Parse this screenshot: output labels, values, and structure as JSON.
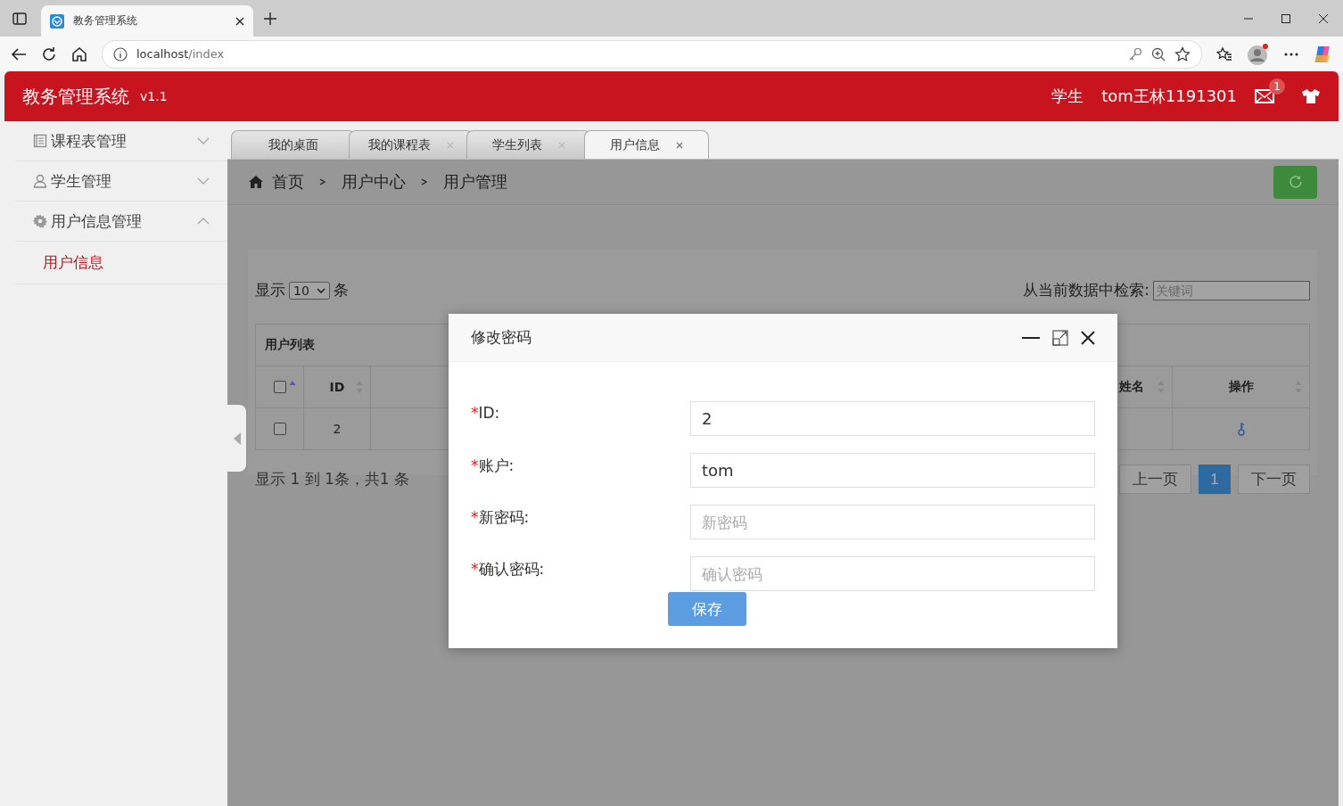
{
  "browser": {
    "tab_title": "教务管理系统",
    "url_host": "localhost",
    "url_path": "/index"
  },
  "header": {
    "title": "教务管理系统",
    "version": "v1.1",
    "role": "学生",
    "user": "tom王林1191301",
    "message_count": "1"
  },
  "sidebar": [
    {
      "label": "课程表管理",
      "kind": "book",
      "expanded": false
    },
    {
      "label": "学生管理",
      "kind": "person",
      "expanded": false
    },
    {
      "label": "用户信息管理",
      "kind": "gear",
      "expanded": true,
      "children": [
        {
          "label": "用户信息",
          "selected": true
        }
      ]
    }
  ],
  "tabs": [
    {
      "label": "我的桌面",
      "selected": false,
      "closable": false
    },
    {
      "label": "我的课程表",
      "selected": false,
      "closable": true
    },
    {
      "label": "学生列表",
      "selected": false,
      "closable": true
    },
    {
      "label": "用户信息",
      "selected": true,
      "closable": true
    }
  ],
  "breadcrumb": [
    "首页",
    "用户中心",
    "用户管理"
  ],
  "toolbar": {
    "show_label": "显示",
    "page_size": "10",
    "unit": "条",
    "search_label": "从当前数据中检索:",
    "search_placeholder": "关键词"
  },
  "table": {
    "title": "用户列表",
    "all_checked": false,
    "columns": [
      {
        "label": "ID"
      },
      {
        "label": "姓名"
      },
      {
        "label": "操作"
      }
    ],
    "rows": [
      {
        "id": "2",
        "checked": false
      }
    ]
  },
  "summary": "显示 1 到 1条，共1 条",
  "pagination": {
    "prev": "上一页",
    "pages": [
      {
        "label": "1",
        "selected": true
      }
    ],
    "next": "下一页"
  },
  "dialog": {
    "title": "修改密码",
    "fields": [
      {
        "mark": "*",
        "label": "ID:",
        "value": "2"
      },
      {
        "mark": "*",
        "label": "账户:",
        "value": "tom"
      },
      {
        "mark": "*",
        "label": "新密码:",
        "placeholder": "新密码"
      },
      {
        "mark": "*",
        "label": "确认密码:",
        "placeholder": "确认密码"
      }
    ],
    "submit": "保存"
  }
}
